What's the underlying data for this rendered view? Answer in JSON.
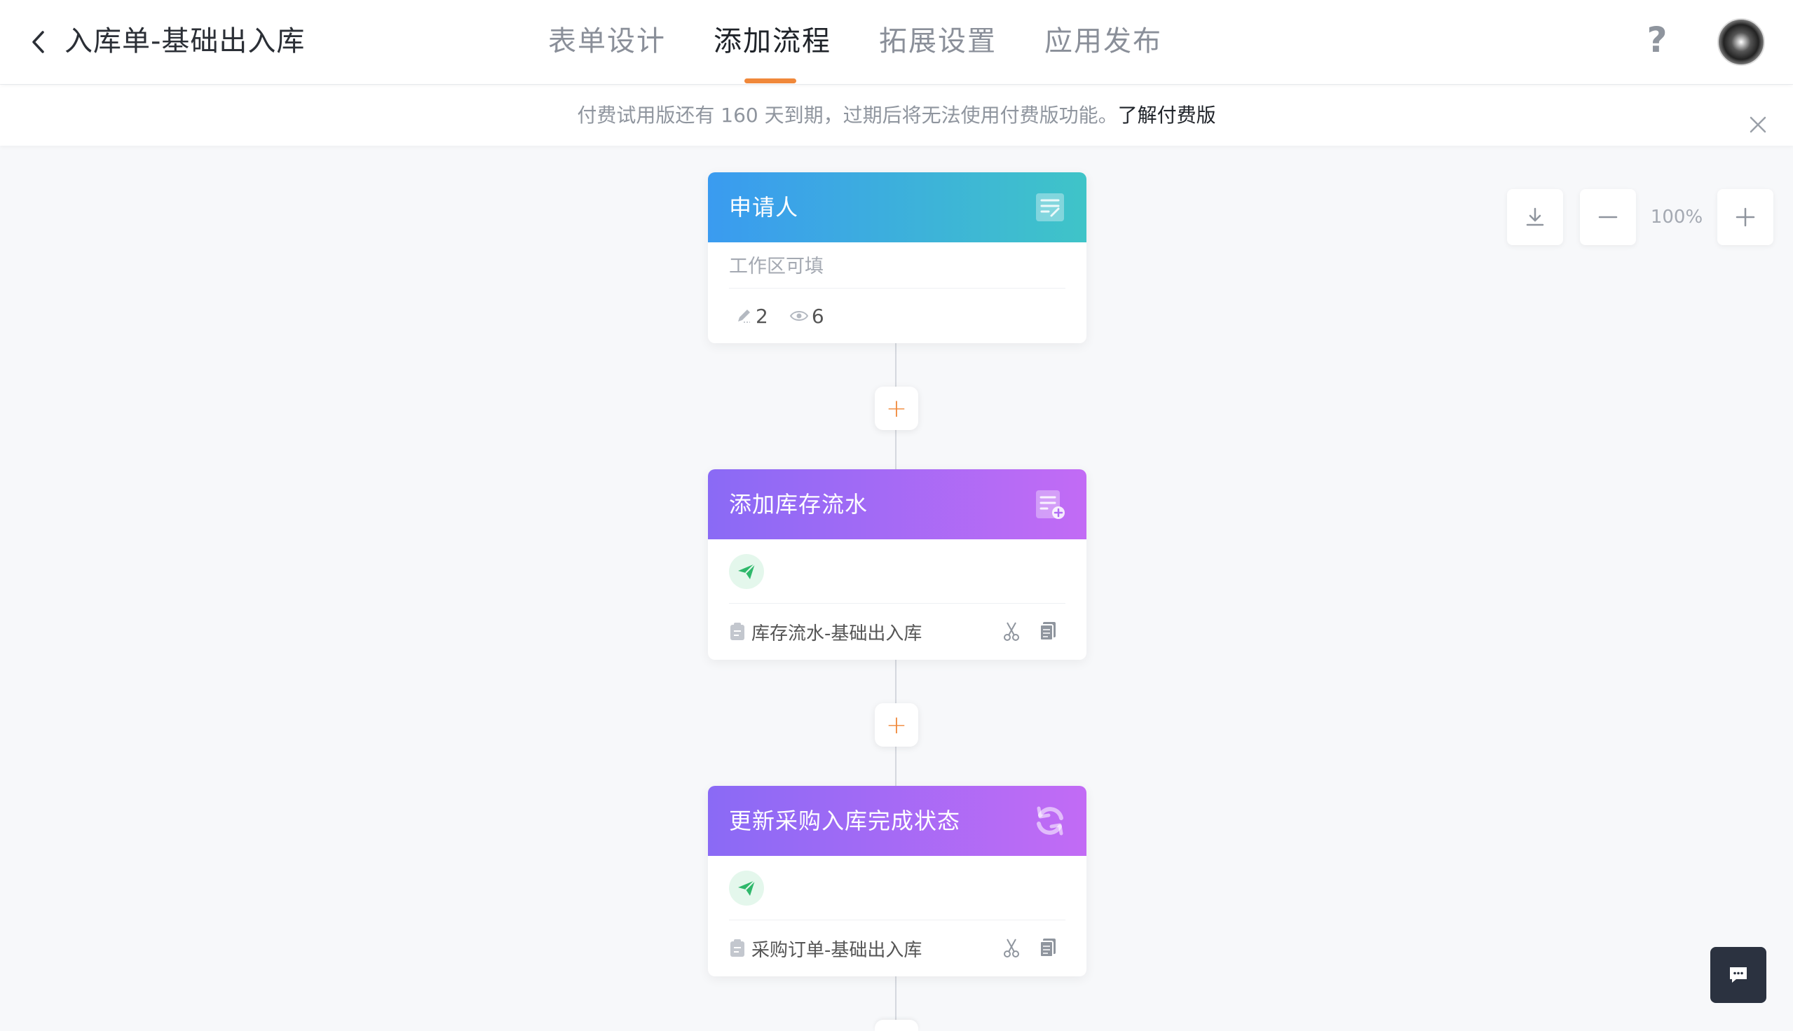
{
  "header": {
    "title": "入库单-基础出入库",
    "tabs": [
      {
        "label": "表单设计"
      },
      {
        "label": "添加流程"
      },
      {
        "label": "拓展设置"
      },
      {
        "label": "应用发布"
      }
    ],
    "active_tab": "添加流程",
    "help_label": "?",
    "accent_color": "#f0883a"
  },
  "notice": {
    "text": "付费试用版还有 160 天到期，过期后将无法使用付费版功能。",
    "link": "了解付费版"
  },
  "zoom": {
    "level": "100%"
  },
  "flow": {
    "applicant": {
      "title": "申请人",
      "subtitle": "工作区可填",
      "edit_count": "2",
      "view_count": "6",
      "icon": "form-icon",
      "color": "#3a9bf0"
    },
    "add_flow_node": {
      "title": "添加库存流水",
      "target": "库存流水-基础出入库",
      "icon": "add-record-icon",
      "color": "#8a6af5"
    },
    "update_node": {
      "title": "更新采购入库完成状态",
      "target": "采购订单-基础出入库",
      "icon": "refresh-icon",
      "color": "#8a6af5"
    },
    "add_button_label": "+"
  }
}
